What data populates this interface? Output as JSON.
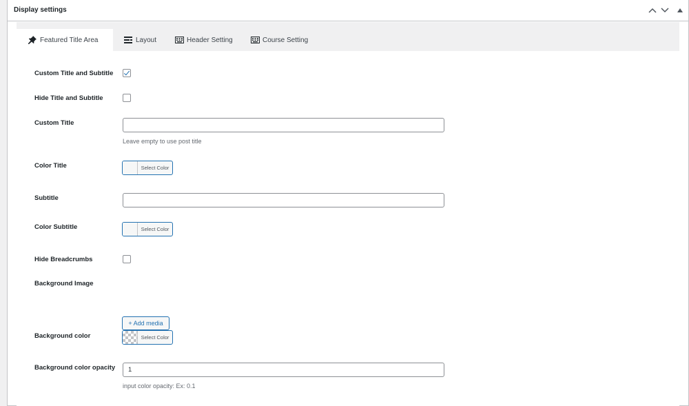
{
  "metabox": {
    "title": "Display settings"
  },
  "tabs": [
    {
      "label": "Featured Title Area",
      "icon": "thumbtack-icon"
    },
    {
      "label": "Layout",
      "icon": "layout-icon"
    },
    {
      "label": "Header Setting",
      "icon": "keyboard-icon"
    },
    {
      "label": "Course Setting",
      "icon": "keyboard-icon"
    }
  ],
  "fields": {
    "custom_title_subtitle": {
      "label": "Custom Title and Subtitle",
      "checked": true
    },
    "hide_title_subtitle": {
      "label": "Hide Title and Subtitle",
      "checked": false
    },
    "custom_title": {
      "label": "Custom Title",
      "value": "",
      "hint": "Leave empty to use post title"
    },
    "color_title": {
      "label": "Color Title",
      "button": "Select Color"
    },
    "subtitle": {
      "label": "Subtitle",
      "value": ""
    },
    "color_subtitle": {
      "label": "Color Subtitle",
      "button": "Select Color"
    },
    "hide_breadcrumbs": {
      "label": "Hide Breadcrumbs",
      "checked": false
    },
    "background_image": {
      "label": "Background Image",
      "button": "+ Add media"
    },
    "background_color": {
      "label": "Background color",
      "button": "Select Color"
    },
    "background_opacity": {
      "label": "Background color opacity",
      "value": "1",
      "hint": "input color opacity: Ex: 0.1"
    }
  },
  "colors": {
    "accent": "#2271b1",
    "border": "#c3c4c7",
    "panel_bg": "#f0f0f1"
  }
}
